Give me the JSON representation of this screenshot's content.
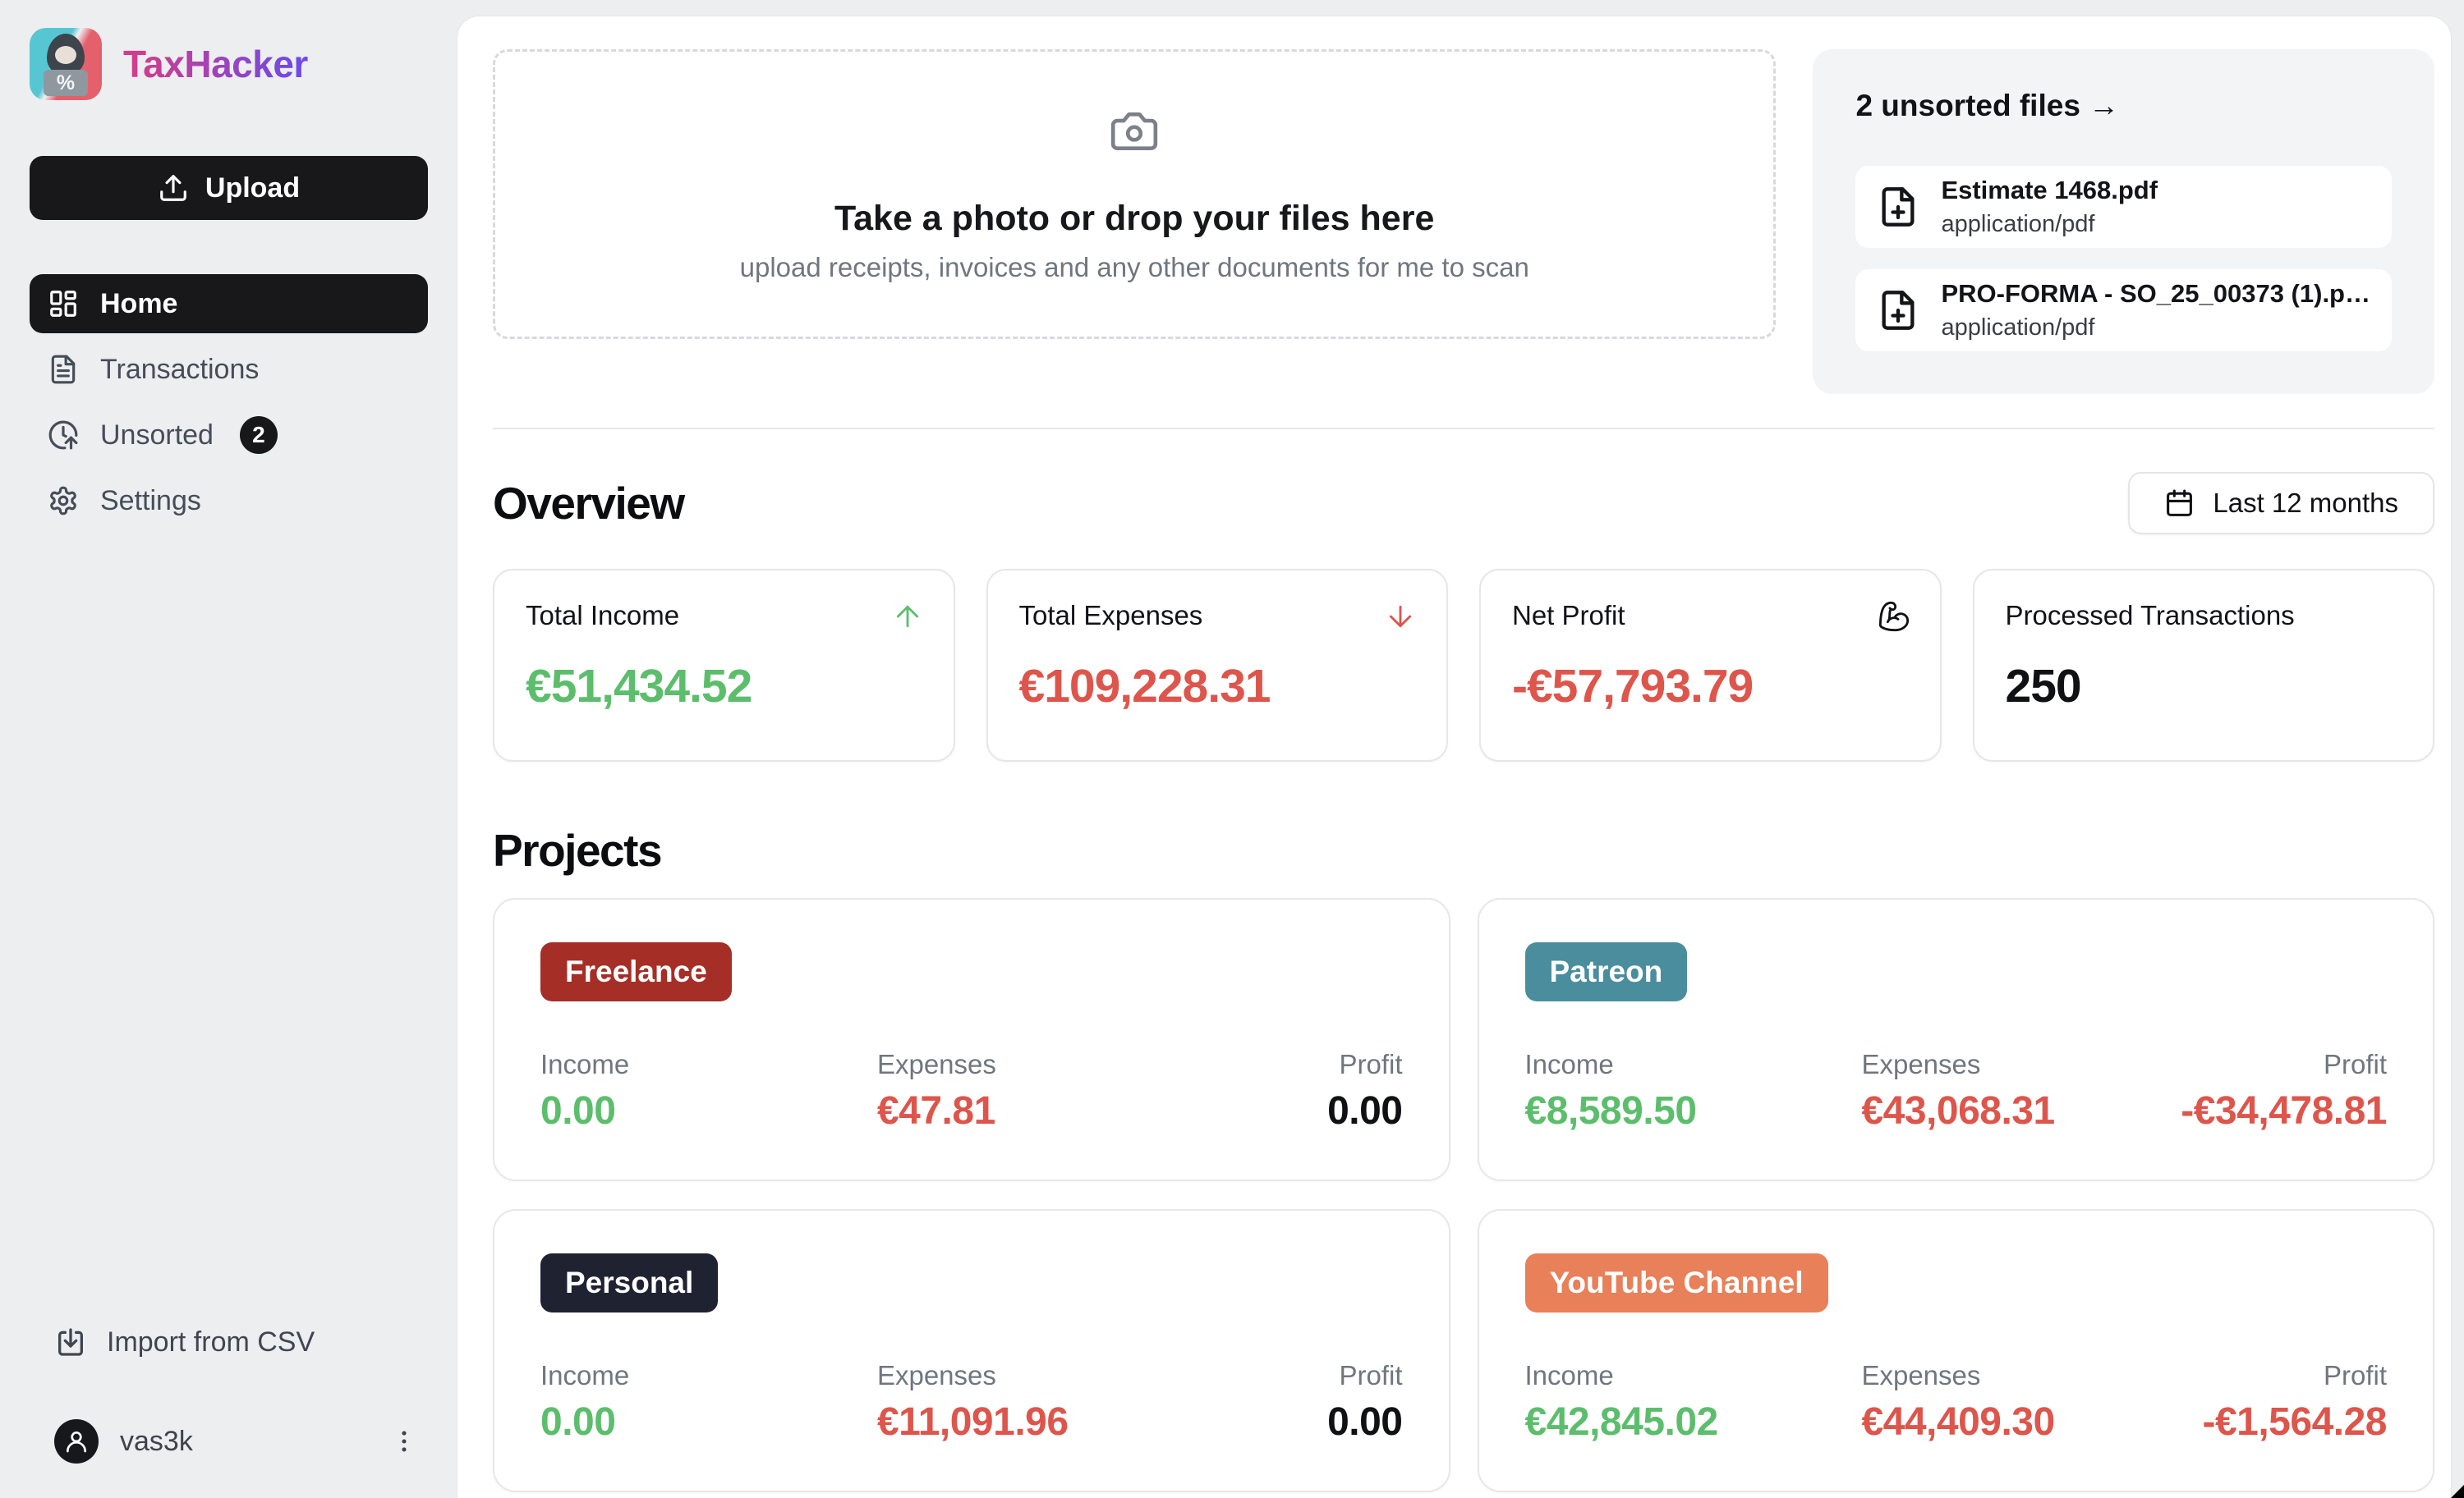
{
  "app": {
    "name": "TaxHacker"
  },
  "sidebar": {
    "upload_button": "Upload",
    "nav": [
      {
        "label": "Home"
      },
      {
        "label": "Transactions"
      },
      {
        "label": "Unsorted",
        "badge": "2"
      },
      {
        "label": "Settings"
      }
    ],
    "import_csv": "Import from CSV",
    "user": {
      "name": "vas3k"
    }
  },
  "dropzone": {
    "title": "Take a photo or drop your files here",
    "subtitle": "upload receipts, invoices and any other documents for me to scan"
  },
  "unsorted_files": {
    "title": "2 unsorted files →",
    "files": [
      {
        "name": "Estimate 1468.pdf",
        "type": "application/pdf"
      },
      {
        "name": "PRO-FORMA - SO_25_00373 (1).p…",
        "type": "application/pdf"
      }
    ]
  },
  "overview": {
    "heading": "Overview",
    "period": "Last 12 months",
    "stats": [
      {
        "label": "Total Income",
        "value": "€51,434.52"
      },
      {
        "label": "Total Expenses",
        "value": "€109,228.31"
      },
      {
        "label": "Net Profit",
        "value": "-€57,793.79"
      },
      {
        "label": "Processed Transactions",
        "value": "250"
      }
    ]
  },
  "projects": {
    "heading": "Projects",
    "col_labels": {
      "income": "Income",
      "expenses": "Expenses",
      "profit": "Profit"
    },
    "cards": [
      {
        "name": "Freelance",
        "income": "0.00",
        "expenses": "€47.81",
        "profit": "0.00"
      },
      {
        "name": "Patreon",
        "income": "€8,589.50",
        "expenses": "€43,068.31",
        "profit": "-€34,478.81"
      },
      {
        "name": "Personal",
        "income": "0.00",
        "expenses": "€11,091.96",
        "profit": "0.00"
      },
      {
        "name": "YouTube Channel",
        "income": "€42,845.02",
        "expenses": "€44,409.30",
        "profit": "-€1,564.28"
      }
    ]
  },
  "colors": {
    "income_green": "#5cbe6c",
    "expense_red": "#dd554b",
    "badge_freelance": "#a52e26",
    "badge_patreon": "#4a8d9d",
    "badge_personal": "#1f2231",
    "badge_youtube": "#e8805a",
    "brand_gradient_start": "#cf3d8e",
    "brand_gradient_end": "#6d49e8",
    "sidebar_bg": "#eceef0",
    "active_item_bg": "#18181b"
  },
  "icons": [
    "upload-icon",
    "dashboard-icon",
    "file-text-icon",
    "clock-arrow-up-icon",
    "gear-icon",
    "import-icon",
    "user-icon",
    "ellipsis-vertical-icon",
    "camera-icon",
    "file-plus-icon",
    "calendar-icon",
    "arrow-up-icon",
    "arrow-down-icon",
    "biceps-icon"
  ]
}
